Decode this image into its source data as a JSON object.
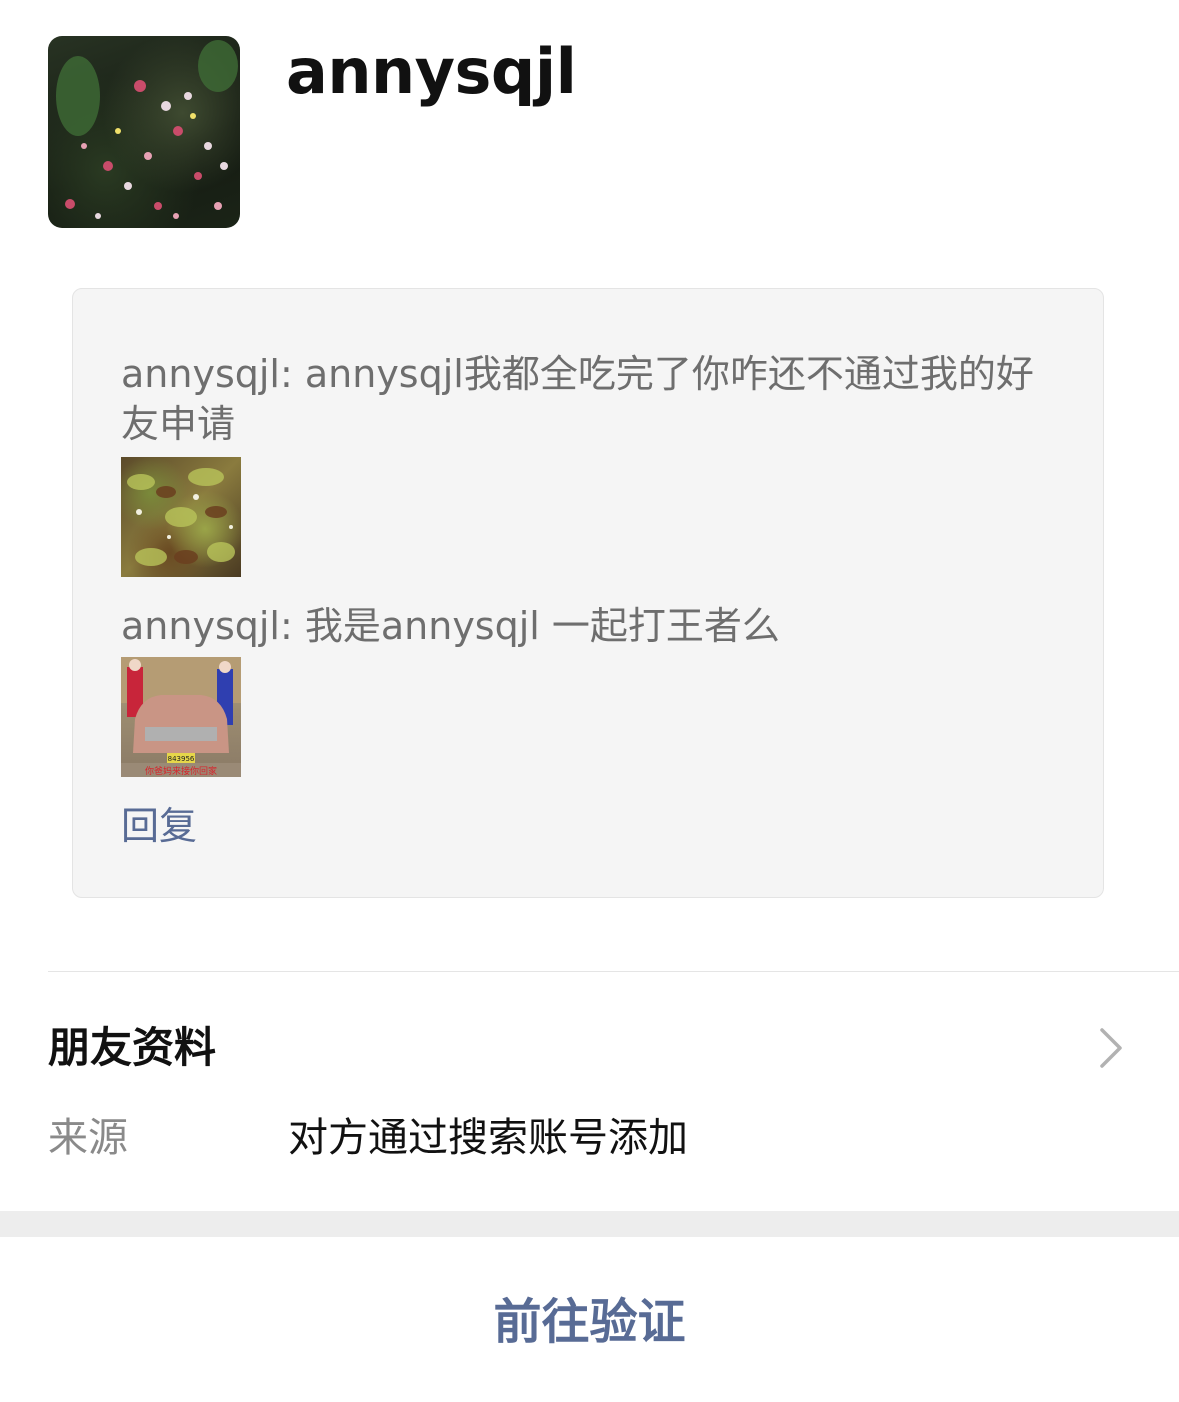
{
  "profile": {
    "name": "annysqjl",
    "avatar_icon": "flower-garden-avatar"
  },
  "messages": [
    {
      "text": "annysqjl: annysqjl我都全吃完了你咋还不通过我的好友申请",
      "thumbnail_icon": "food-photo-thumbnail"
    },
    {
      "text": "annysqjl: 我是annysqjl 一起打王者么",
      "thumbnail_icon": "car-meme-thumbnail",
      "thumbnail_plate": "843956",
      "thumbnail_caption": "你爸妈来接你回家"
    }
  ],
  "reply_label": "回复",
  "friend_info": {
    "title": "朋友资料",
    "source_label": "来源",
    "source_value": "对方通过搜索账号添加"
  },
  "verify_label": "前往验证",
  "colors": {
    "link": "#586b95",
    "message_text": "#6e6e6e",
    "box_background": "#f5f5f5"
  }
}
